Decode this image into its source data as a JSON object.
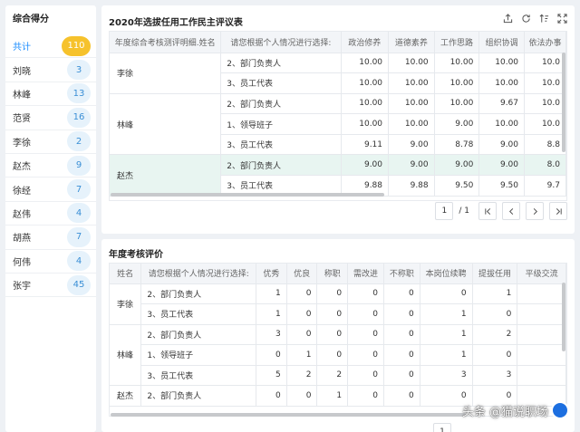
{
  "left_panel": {
    "title": "综合得分",
    "items": [
      {
        "name": "共计",
        "count": "110"
      },
      {
        "name": "刘晓",
        "count": "3"
      },
      {
        "name": "林峰",
        "count": "13"
      },
      {
        "name": "范贤",
        "count": "16"
      },
      {
        "name": "李徐",
        "count": "2"
      },
      {
        "name": "赵杰",
        "count": "9"
      },
      {
        "name": "徐经",
        "count": "7"
      },
      {
        "name": "赵伟",
        "count": "4"
      },
      {
        "name": "胡燕",
        "count": "7"
      },
      {
        "name": "何伟",
        "count": "4"
      },
      {
        "name": "张宇",
        "count": "45"
      }
    ]
  },
  "eval_table": {
    "title": "2020年选拔任用工作民主评议表",
    "headers": [
      "年度综合考核测评明细.姓名",
      "请您根据个人情况进行选择:",
      "政治修养",
      "道德素养",
      "工作思路",
      "组织协调",
      "依法办事"
    ],
    "groups": [
      {
        "name": "李徐",
        "rows": [
          {
            "role": "2、部门负责人",
            "v": [
              "10.00",
              "10.00",
              "10.00",
              "10.00",
              "10.0"
            ]
          },
          {
            "role": "3、员工代表",
            "v": [
              "10.00",
              "10.00",
              "10.00",
              "10.00",
              "10.0"
            ]
          }
        ]
      },
      {
        "name": "林峰",
        "rows": [
          {
            "role": "2、部门负责人",
            "v": [
              "10.00",
              "10.00",
              "10.00",
              "9.67",
              "10.0"
            ]
          },
          {
            "role": "1、领导班子",
            "v": [
              "10.00",
              "10.00",
              "9.00",
              "10.00",
              "10.0"
            ]
          },
          {
            "role": "3、员工代表",
            "v": [
              "9.11",
              "9.00",
              "8.78",
              "9.00",
              "8.8"
            ]
          }
        ]
      },
      {
        "name": "赵杰",
        "rows": [
          {
            "role": "2、部门负责人",
            "v": [
              "9.00",
              "9.00",
              "9.00",
              "9.00",
              "8.0"
            ]
          },
          {
            "role": "3、员工代表",
            "v": [
              "9.88",
              "9.88",
              "9.50",
              "9.50",
              "9.7"
            ]
          }
        ]
      }
    ],
    "pager": {
      "current": "1",
      "total": "/ 1"
    }
  },
  "annual_table": {
    "title": "年度考核评价",
    "headers": [
      "姓名",
      "请您根据个人情况进行选择:",
      "优秀",
      "优良",
      "称职",
      "需改进",
      "不称职",
      "本岗位续聘",
      "提拔任用",
      "平级交流"
    ],
    "groups": [
      {
        "name": "李徐",
        "rows": [
          {
            "role": "2、部门负责人",
            "v": [
              "1",
              "0",
              "0",
              "0",
              "0",
              "0",
              "1",
              ""
            ]
          },
          {
            "role": "3、员工代表",
            "v": [
              "1",
              "0",
              "0",
              "0",
              "0",
              "1",
              "0",
              ""
            ]
          }
        ]
      },
      {
        "name": "林峰",
        "rows": [
          {
            "role": "2、部门负责人",
            "v": [
              "3",
              "0",
              "0",
              "0",
              "0",
              "1",
              "2",
              ""
            ]
          },
          {
            "role": "1、领导班子",
            "v": [
              "0",
              "1",
              "0",
              "0",
              "0",
              "1",
              "0",
              ""
            ]
          },
          {
            "role": "3、员工代表",
            "v": [
              "5",
              "2",
              "2",
              "0",
              "0",
              "3",
              "3",
              ""
            ]
          }
        ]
      },
      {
        "name": "赵杰",
        "rows": [
          {
            "role": "2、部门负责人",
            "v": [
              "0",
              "0",
              "1",
              "0",
              "0",
              "0",
              "0",
              ""
            ]
          }
        ]
      }
    ],
    "pager": {
      "current": "1"
    }
  },
  "watermark": "头条 @猫说职场",
  "colors": {
    "accent": "#1a8cff",
    "gold_badge": "#f6c22c",
    "badge_bg": "#e6f2fb",
    "highlight_row": "#e8f5f1"
  },
  "icons": [
    "export-icon",
    "refresh-icon",
    "sort-icon",
    "fullscreen-icon",
    "first-page-icon",
    "prev-page-icon",
    "next-page-icon",
    "last-page-icon"
  ]
}
